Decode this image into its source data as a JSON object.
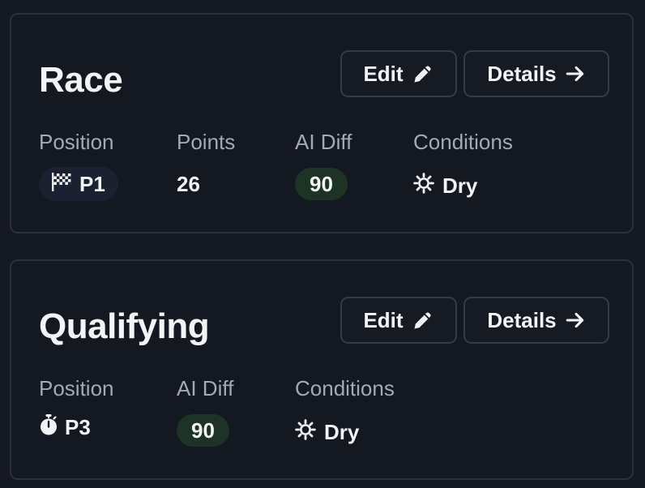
{
  "race": {
    "title": "Race",
    "edit_label": "Edit",
    "details_label": "Details",
    "position_label": "Position",
    "position_value": "P1",
    "position_icon": "checkered-flag-icon",
    "points_label": "Points",
    "points_value": "26",
    "ai_diff_label": "AI Diff",
    "ai_diff_value": "90",
    "conditions_label": "Conditions",
    "conditions_value": "Dry",
    "conditions_icon": "sun-icon"
  },
  "qualifying": {
    "title": "Qualifying",
    "edit_label": "Edit",
    "details_label": "Details",
    "position_label": "Position",
    "position_value": "P3",
    "position_icon": "stopwatch-icon",
    "ai_diff_label": "AI Diff",
    "ai_diff_value": "90",
    "conditions_label": "Conditions",
    "conditions_value": "Dry",
    "conditions_icon": "sun-icon"
  },
  "colors": {
    "background": "#141821",
    "card_border": "#2b303b",
    "label": "#a4a9b3",
    "ai_diff_pill": "#1c3325"
  }
}
